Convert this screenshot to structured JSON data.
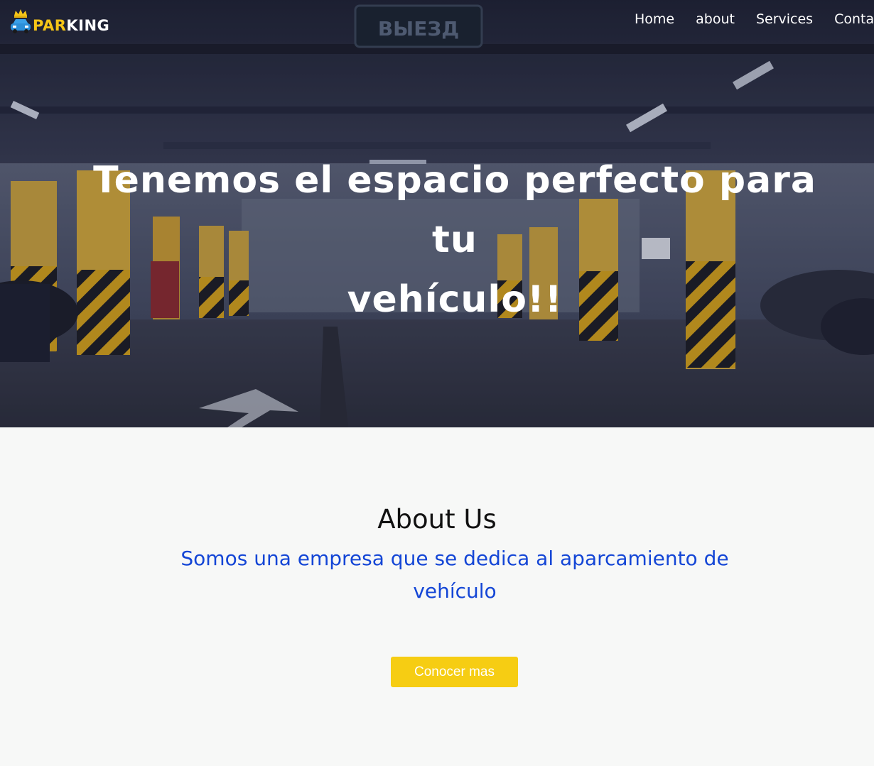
{
  "brand": {
    "logo_part1": "PAR",
    "logo_part2": "KING",
    "accent_color": "#f5c518"
  },
  "nav": {
    "items": [
      {
        "label": "Home",
        "icon": ""
      },
      {
        "label": "about",
        "icon": ""
      },
      {
        "label": "Services",
        "icon": ""
      },
      {
        "label": "Conta",
        "icon": ""
      }
    ]
  },
  "hero": {
    "title_line1": "Tenemos el espacio perfecto para tu",
    "title_line2": "vehículo!!",
    "sign_text": "ВЫЕЗД"
  },
  "about": {
    "title": "About Us",
    "description_line1": "Somos una empresa que se dedica al aparcamiento de",
    "description_line2": "vehículo",
    "button_label": "Conocer mas",
    "text_color": "#1446d6",
    "button_color": "#f6cd13"
  }
}
